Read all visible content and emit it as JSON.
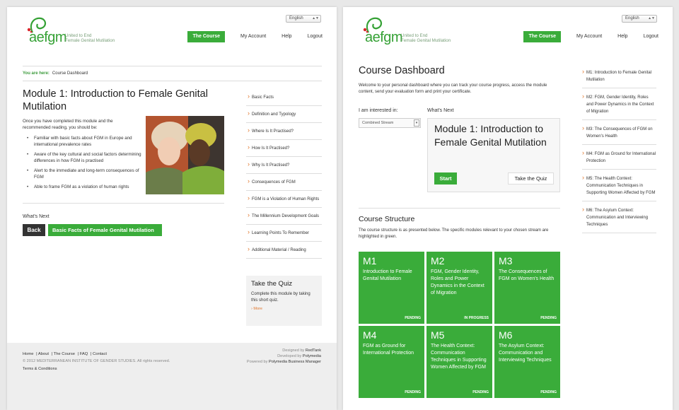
{
  "brand": {
    "wordmark": "aefgm",
    "tagline_1": "United to End",
    "tagline_2": "Female Genital Mutilation",
    "green": "#3aac3a",
    "accent": "#e1762b"
  },
  "lang": "English",
  "nav": [
    "The Course",
    "My Account",
    "Help",
    "Logout"
  ],
  "left": {
    "crumb_label": "You are here:",
    "crumb": "Course Dashboard",
    "title": "Module 1: Introduction to Female Genital Mutilation",
    "intro": "Once you have completed this module and the recommended reading, you should be:",
    "bullets": [
      "Familiar with basic facts about FGM in Europe and international prevalence rates",
      "Aware of the key cultural and social factors determining differences in how FGM is practised",
      "Alert to the immediate and long-term consequences of FGM",
      "Able to frame FGM as a violation of human rights"
    ],
    "whats_next": "What's Next",
    "back": "Back",
    "next": "Basic Facts of Female Genital Mutilation",
    "sidebar": [
      "Basic Facts",
      "Definition and Typology",
      "Where Is It Practised?",
      "How Is It Practised?",
      "Why Is It Practised?",
      "Consequences of FGM",
      "FGM is a Violation of Human Rights",
      "The Millennium Development Goals",
      "Learning Points To Remember",
      "Additional Material / Reading"
    ],
    "quiz_title": "Take the Quiz",
    "quiz_desc": "Complete this module by taking this short quiz.",
    "quiz_more": "More"
  },
  "footer": {
    "links": [
      "Home",
      "About",
      "The Course",
      "FAQ",
      "Contact"
    ],
    "copyright": "© 2012 MEDITERRANEAN INSTITUTE OF GENDER STUDIES. All rights reserved.",
    "terms": "Terms & Conditions",
    "designed_pre": "Designed by",
    "designed": "RedTank",
    "developed_pre": "Developed by",
    "developed": "Polymedia",
    "powered_pre": "Powered by",
    "powered": "Polymedia Business Manager"
  },
  "right": {
    "title": "Course Dashboard",
    "intro": "Welcome to your personal dashboard where you can track your course progress, access the module content, send your evaluation form and print your certificate.",
    "interest_label": "I am interested in:",
    "stream": "Combined Stream",
    "whats_next": "What's Next",
    "next_module": "Module 1: Introduction to Female Genital Mutilation",
    "start": "Start",
    "quiz": "Take the Quiz",
    "structure_title": "Course Structure",
    "structure_desc": "The course structure is as presented below. The specific modules relevant to your chosen stream are highlighted in green.",
    "modules": [
      {
        "n": "M1",
        "title": "Introduction to Female Genital Mutilation",
        "status": "PENDING"
      },
      {
        "n": "M2",
        "title": "FGM, Gender Identity, Roles and Power Dynamics in the Context of Migration",
        "status": "IN PROGRESS"
      },
      {
        "n": "M3",
        "title": "The Consequences of FGM on Women's Health",
        "status": "PENDING"
      },
      {
        "n": "M4",
        "title": "FGM as Ground for International Protection",
        "status": "PENDING"
      },
      {
        "n": "M5",
        "title": "The Health Context: Communication Techniques in Supporting Women Affected by FGM",
        "status": "PENDING"
      },
      {
        "n": "M6",
        "title": "The Asylum Context: Communication and Interviewing Techniques",
        "status": "PENDING"
      }
    ],
    "sidebar": [
      "M1: Introduction to Female Genital Mutilation",
      "M2: FGM, Gender Identity, Roles and Power Dynamics in the Context of Migration",
      "M3: The Consequences of FGM on Women's Health",
      "M4: FGM as Ground for International Protection",
      "M5: The Health Context: Communication Techniques in Supporting Women Affected by FGM",
      "M6: The Asylum Context: Communication and Interviewing Techniques"
    ]
  }
}
